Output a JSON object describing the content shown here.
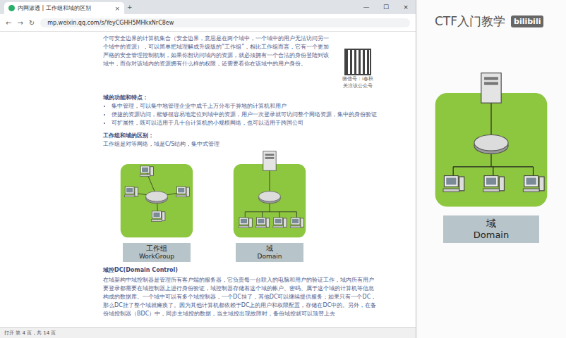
{
  "browser": {
    "tab_title": "内网渗透 | 工作组和域的区别",
    "tab_close": "×",
    "new_tab": "+",
    "controls": [
      "—",
      "☐",
      "×"
    ],
    "nav": [
      "←",
      "→",
      "↻"
    ],
    "url": "mp.weixin.qq.com/s/YeyCGHH5MHkxNrC8ew",
    "status": "打开 第 4 页，共 14 页"
  },
  "article": {
    "intro": "个可安全边界的计算机集合（安全边界，意思是在两个域中，一个域中的用户无法访问另一个域中的资源），可以简单把域理解成升级版的“工作组”，相比工作组而言，它有一个更加严格的安全管理控制机制，如果你想访问域内的资源，就必须拥有一个合法的身份登陆到该域中，而你对该域内的资源拥有什么样的权限，还需要看你在该域中的用户身份。",
    "qr_caption": [
      "微信号：i春秋",
      "关注该公众号"
    ],
    "features_title": "域的功能和特点：",
    "features": [
      "集中管理，可以集中地管理企业中成千上万分布于异地的计算机和用户",
      "便捷的资源访问，能够很容易地定位到域中的资源，用户一次登录就可访问整个网络资源，集中的身份验证",
      "可扩展性，既可以适用于几十台计算机的小规模网络，也可以适用于跨国公司"
    ],
    "diff_title": "工作组和域的区别：",
    "diff_text": "工作组是对等网络，域是C/S结构，集中式管理",
    "figures": [
      {
        "kind": "workgroup",
        "label_cn": "工作组",
        "label_en": "WorkGroup"
      },
      {
        "kind": "domain",
        "label_cn": "域",
        "label_en": "Domain"
      }
    ],
    "dc_title": "域控DC(Domain Control)",
    "dc_text": "在域架构中域控制器是管理所有客户端的服务器，它负责每一台联入的电脑和用户的验证工作，域内所有用户要登录都需要在域控制器上进行身份验证，域控制器存储着这个域的帐户、密码、属于这个域的计算机等信息构成的数据库。一个域中可以有多个域控制器，一个DC挂了，其他DC可以继续提供服务；如果只有一个DC，那么DC挂了整个域就瘫痪了。因为其他计算机都依赖于DC上的用户和权限配置，存储在DC中的。另外，在备份域控制器（BDC）中，同步主域控的数据，当主域控出现故障时，备份域控就可以顶替上去"
  },
  "video": {
    "title": "CTF入门教学",
    "logo": "bilibili",
    "figure": {
      "kind": "domain",
      "label_cn": "域",
      "label_en": "Domain"
    }
  }
}
